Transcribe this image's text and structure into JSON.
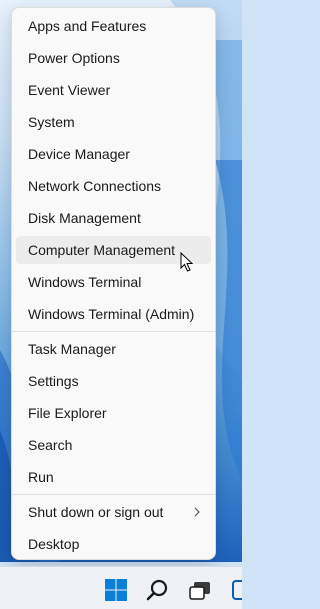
{
  "context_menu": {
    "items": [
      {
        "label": "Apps and Features"
      },
      {
        "label": "Power Options"
      },
      {
        "label": "Event Viewer"
      },
      {
        "label": "System"
      },
      {
        "label": "Device Manager"
      },
      {
        "label": "Network Connections"
      },
      {
        "label": "Disk Management"
      },
      {
        "label": "Computer Management"
      },
      {
        "label": "Windows Terminal"
      },
      {
        "label": "Windows Terminal (Admin)"
      },
      {
        "label": "Task Manager"
      },
      {
        "label": "Settings"
      },
      {
        "label": "File Explorer"
      },
      {
        "label": "Search"
      },
      {
        "label": "Run"
      },
      {
        "label": "Shut down or sign out"
      },
      {
        "label": "Desktop"
      }
    ],
    "hovered_item": "Computer Management",
    "submenu_item": "Shut down or sign out"
  },
  "taskbar": {
    "icons": [
      "windows-start-icon",
      "search-icon",
      "task-view-icon",
      "widgets-icon"
    ]
  },
  "colors": {
    "accent": "#0078d4",
    "menu_background": "#f9f9f9",
    "hover_background": "#ececec",
    "taskbar_background": "#eef1f6"
  }
}
